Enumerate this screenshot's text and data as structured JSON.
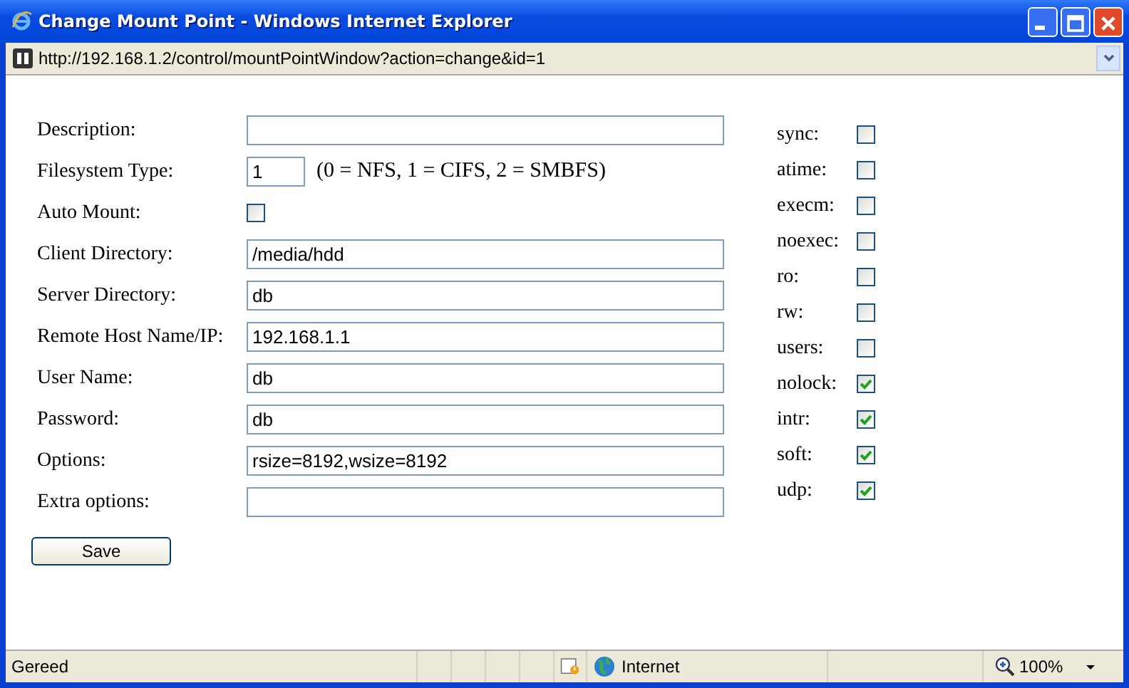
{
  "window": {
    "title": "Change Mount Point - Windows Internet Explorer"
  },
  "address_bar": {
    "url": "http://192.168.1.2/control/mountPointWindow?action=change&id=1"
  },
  "fields": [
    {
      "label": "Description:",
      "kind": "text"
    },
    {
      "label": "Filesystem Type:",
      "kind": "short",
      "value": "1",
      "hint": "(0 = NFS, 1 = CIFS, 2 = SMBFS)"
    },
    {
      "label": "Auto Mount:",
      "kind": "checkbox",
      "checked": false
    },
    {
      "label": "Client Directory:",
      "kind": "text",
      "value": "/media/hdd"
    },
    {
      "label": "Server Directory:",
      "kind": "text",
      "value": "db"
    },
    {
      "label": "Remote Host Name/IP:",
      "kind": "text",
      "value": "192.168.1.1"
    },
    {
      "label": "User Name:",
      "kind": "text",
      "value": "db"
    },
    {
      "label": "Password:",
      "kind": "text",
      "value": "db"
    },
    {
      "label": "Options:",
      "kind": "text",
      "value": "rsize=8192,wsize=8192"
    },
    {
      "label": "Extra options:",
      "kind": "text"
    }
  ],
  "mount_options": [
    {
      "label": "sync:",
      "checked": false
    },
    {
      "label": "atime:",
      "checked": false
    },
    {
      "label": "execm:",
      "checked": false
    },
    {
      "label": "noexec:",
      "checked": false
    },
    {
      "label": "ro:",
      "checked": false
    },
    {
      "label": "rw:",
      "checked": false
    },
    {
      "label": "users:",
      "checked": false
    },
    {
      "label": "nolock:",
      "checked": true
    },
    {
      "label": "intr:",
      "checked": true
    },
    {
      "label": "soft:",
      "checked": true
    },
    {
      "label": "udp:",
      "checked": true
    }
  ],
  "save_button": "Save",
  "status_bar": {
    "status": "Gereed",
    "zone": "Internet",
    "zoom": "100%"
  }
}
